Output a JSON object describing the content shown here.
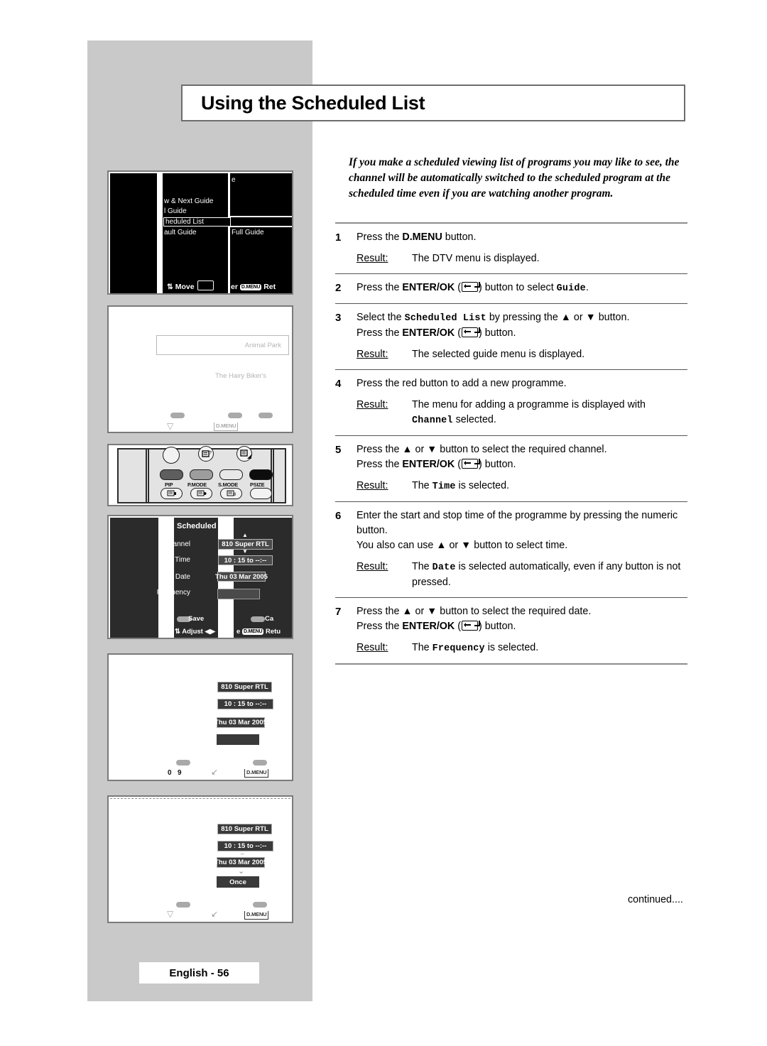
{
  "page": {
    "title": "Using the Scheduled List",
    "footer_label": "English - 56",
    "continued": "continued....",
    "intro": "If you make a scheduled viewing list of programs you may like to see, the channel will be automatically switched to the scheduled program at the scheduled time even if  you are watching another program."
  },
  "steps": [
    {
      "num": "1",
      "lines": [
        "Press the D.MENU button."
      ],
      "result_label": "Result:",
      "result": "The DTV menu is displayed."
    },
    {
      "num": "2",
      "lines": [
        "Press the ENTER/OK ( ) button to select Guide."
      ],
      "result_label": "",
      "result": ""
    },
    {
      "num": "3",
      "lines": [
        "Select the Scheduled List by pressing the ▲ or ▼ button.",
        "Press the ENTER/OK ( ) button."
      ],
      "result_label": "Result:",
      "result": "The selected guide menu is displayed."
    },
    {
      "num": "4",
      "lines": [
        "Press the red button to add a new programme."
      ],
      "result_label": "Result:",
      "result": "The menu for adding a programme is displayed with Channel selected."
    },
    {
      "num": "5",
      "lines": [
        "Press the ▲ or ▼ button to select the required channel.",
        "Press the ENTER/OK ( ) button."
      ],
      "result_label": "Result:",
      "result": "The Time is selected."
    },
    {
      "num": "6",
      "lines": [
        "Enter the start and stop time of the programme by pressing the numeric button.",
        "You also can use ▲ or ▼ button to select time."
      ],
      "result_label": "Result:",
      "result": "The Date is selected automatically, even if any button is not pressed."
    },
    {
      "num": "7",
      "lines": [
        "Press the ▲ or ▼ button to select the required date.",
        "Press the ENTER/OK ( ) button."
      ],
      "result_label": "Result:",
      "result": "The Frequency is selected."
    }
  ],
  "step_text": {
    "s1_a": "Press the ",
    "s1_b": "D.MENU",
    "s1_c": " button.",
    "s1_result_label": "Result:",
    "s1_result": "The DTV menu is displayed.",
    "s2_a": "Press the ",
    "s2_b": "ENTER/OK",
    "s2_c": " (",
    "s2_d": ") button to select ",
    "s2_mono": "Guide",
    "s2_e": ".",
    "s3_a": "Select the ",
    "s3_mono": "Scheduled List",
    "s3_b": " by pressing the ▲ or ▼ button.",
    "s3_c": "Press the ",
    "s3_d": "ENTER/OK",
    "s3_e": " (",
    "s3_f": ") button.",
    "s3_result_label": "Result:",
    "s3_result": "The selected guide menu is displayed.",
    "s4_a": "Press the red button to add a new programme.",
    "s4_result_label": "Result:",
    "s4_result_a": "The menu for adding a programme is displayed with ",
    "s4_mono": "Channel",
    "s4_result_b": " selected.",
    "s5_a": "Press the ▲ or ▼ button to select the required channel.",
    "s5_b": "Press the ",
    "s5_c": "ENTER/OK",
    "s5_d": " (",
    "s5_e": ") button.",
    "s5_result_label": "Result:",
    "s5_result_a": "The ",
    "s5_mono": "Time",
    "s5_result_b": " is selected.",
    "s6_a": "Enter the start and stop time of the programme by pressing the numeric button.",
    "s6_b": "You also can use ▲ or ▼ button to select time.",
    "s6_result_label": "Result:",
    "s6_result_a": "The ",
    "s6_mono": "Date",
    "s6_result_b": " is selected automatically, even if any button is not pressed.",
    "s7_a": "Press the ▲ or ▼ button to select the required date.",
    "s7_b": "Press the ",
    "s7_c": "ENTER/OK",
    "s7_d": " (",
    "s7_e": ") button.",
    "s7_result_label": "Result:",
    "s7_result_a": "The ",
    "s7_mono": "Frequency",
    "s7_result_b": " is selected."
  },
  "illustrations": {
    "panel1": {
      "name": "guide-menu-osd",
      "items": [
        "w & Next Guide",
        "l Guide",
        "heduled List",
        "ault Guide"
      ],
      "right_item": "Full Guide",
      "right_top_fragment": "e",
      "footer_move": "Move",
      "footer_enter": "er",
      "footer_dmenu": "D.MENU",
      "footer_return": "Ret"
    },
    "panel2": {
      "name": "faded-epg",
      "highlight": "Animal Park",
      "secondary": "The Hairy Biker's",
      "dmenu": "D.MENU"
    },
    "panel3": {
      "name": "remote-control-closeup",
      "labels": [
        "PIP",
        "P.MODE",
        "S.MODE",
        "PSIZE"
      ]
    },
    "panel4": {
      "name": "scheduled-list-form",
      "title": "Scheduled List",
      "labels": {
        "channel": "Channel",
        "time": "Time",
        "date": "Date",
        "frequency": "Frequency"
      },
      "values": {
        "channel": "810 Super RTL",
        "time": "10 : 15 to --:--",
        "date": "Thu 03 Mar 2005",
        "frequency": ""
      },
      "footer": {
        "save": "Save",
        "cancel": "Ca",
        "adjust": "Adjust",
        "move": "e",
        "dmenu": "D.MENU",
        "return": "Retu"
      }
    },
    "panel5": {
      "name": "scheduled-list-values-step6",
      "channel": "810 Super RTL",
      "time": "10 : 15 to --:--",
      "date": "Thu 03 Mar 2005",
      "frequency": "",
      "numeric_0": "0",
      "numeric_9": "9",
      "dmenu": "D.MENU"
    },
    "panel6": {
      "name": "scheduled-list-values-step7",
      "channel": "810 Super RTL",
      "time": "10 : 15 to --:--",
      "date": "Thu 03 Mar 2005",
      "frequency": "Once",
      "dmenu": "D.MENU"
    }
  },
  "colors": {
    "band_gray": "#c9c9c9",
    "panel_border": "#7a7a7a",
    "osd_black": "#000000",
    "form_dark": "#2b2b2b",
    "chip_dark": "#3a3a3a",
    "faded_gray": "#b4b4b4"
  }
}
